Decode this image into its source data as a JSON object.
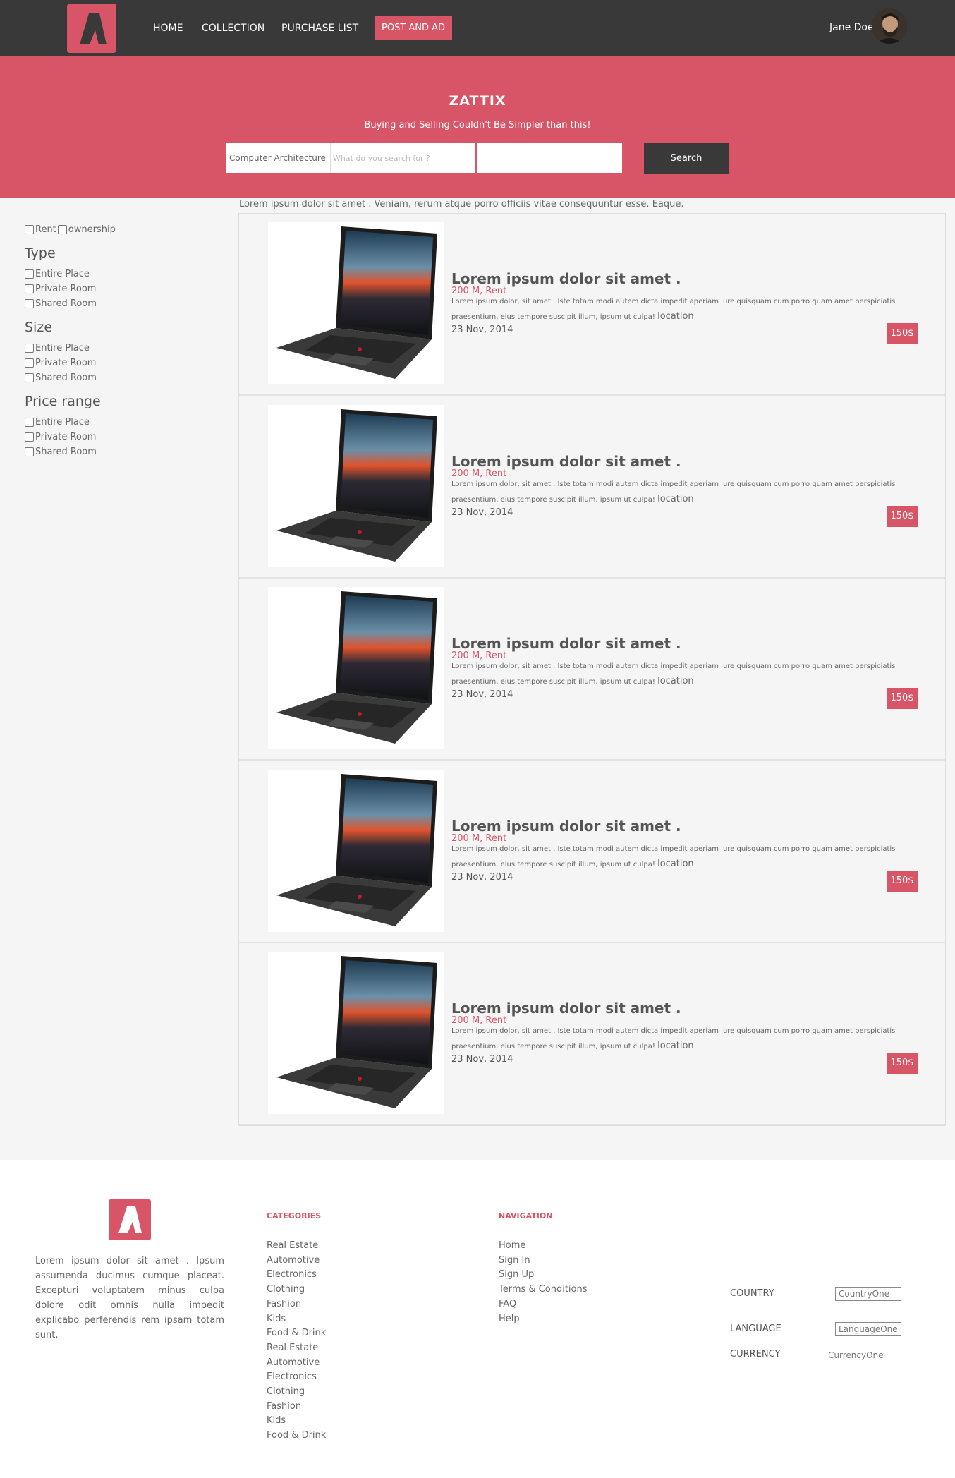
{
  "nav": {
    "home": "HOME",
    "collection": "COLLECTION",
    "purchase_list": "PURCHASE LIST",
    "post_ad": "POST AND AD",
    "user_name": "Jane Doe",
    "logo_icon": "brand-a-logo",
    "avatar_icon": "user-avatar"
  },
  "hero": {
    "title": "ZATTIX",
    "subtitle": "Buying and Selling Couldn't Be Simpler than this!",
    "category": "Computer Architecture",
    "search_placeholder": "What do you search for ?",
    "location_value": "",
    "search_button": "Search"
  },
  "sidebar": {
    "rent": "Rent",
    "ownership": "ownership",
    "groups": [
      {
        "title": "Type",
        "items": [
          "Entire Place",
          "Private Room",
          "Shared Room"
        ]
      },
      {
        "title": "Size",
        "items": [
          "Entire Place",
          "Private Room",
          "Shared Room"
        ]
      },
      {
        "title": "Price range",
        "items": [
          "Entire Place",
          "Private Room",
          "Shared Room"
        ]
      }
    ]
  },
  "listings": {
    "intro": "Lorem ipsum dolor sit amet . Veniam, rerum atque porro officiis vitae consequuntur esse. Eaque.",
    "items": [
      {
        "title": "Lorem ipsum dolor sit amet .",
        "subtitle": "200 M, Rent",
        "description": "Lorem ipsum dolor, sit amet . Iste totam modi autem dicta impedit aperiam iure quisquam cum porro quam amet perspiciatis praesentium, eius tempore suscipit illum, ipsum ut culpa!",
        "location": "location",
        "date": "23 Nov, 2014",
        "price": "150$"
      },
      {
        "title": "Lorem ipsum dolor sit amet .",
        "subtitle": "200 M, Rent",
        "description": "Lorem ipsum dolor, sit amet . Iste totam modi autem dicta impedit aperiam iure quisquam cum porro quam amet perspiciatis praesentium, eius tempore suscipit illum, ipsum ut culpa!",
        "location": "location",
        "date": "23 Nov, 2014",
        "price": "150$"
      },
      {
        "title": "Lorem ipsum dolor sit amet .",
        "subtitle": "200 M, Rent",
        "description": "Lorem ipsum dolor, sit amet . Iste totam modi autem dicta impedit aperiam iure quisquam cum porro quam amet perspiciatis praesentium, eius tempore suscipit illum, ipsum ut culpa!",
        "location": "location",
        "date": "23 Nov, 2014",
        "price": "150$"
      },
      {
        "title": "Lorem ipsum dolor sit amet .",
        "subtitle": "200 M, Rent",
        "description": "Lorem ipsum dolor, sit amet . Iste totam modi autem dicta impedit aperiam iure quisquam cum porro quam amet perspiciatis praesentium, eius tempore suscipit illum, ipsum ut culpa!",
        "location": "location",
        "date": "23 Nov, 2014",
        "price": "150$"
      },
      {
        "title": "Lorem ipsum dolor sit amet .",
        "subtitle": "200 M, Rent",
        "description": "Lorem ipsum dolor, sit amet . Iste totam modi autem dicta impedit aperiam iure quisquam cum porro quam amet perspiciatis praesentium, eius tempore suscipit illum, ipsum ut culpa!",
        "location": "location",
        "date": "23 Nov, 2014",
        "price": "150$"
      }
    ]
  },
  "footer": {
    "about": "Lorem ipsum dolor sit amet . Ipsum assumenda ducimus cumque placeat. Excepturi voluptatem minus culpa dolore odit omnis nulla impedit explicabo perferendis rem ipsam totam sunt,",
    "categories_title": "CATEGORIES",
    "categories": [
      "Real Estate",
      "Automotive",
      "Electronics",
      "Clothing",
      "Fashion",
      "Kids",
      "Food & Drink",
      "Real Estate",
      "Automotive",
      "Electronics",
      "Clothing",
      "Fashion",
      "Kids",
      "Food & Drink"
    ],
    "navigation_title": "NAVIGATION",
    "navigation": [
      "Home",
      "Sign In",
      "Sign Up",
      "Terms & Conditions",
      "FAQ",
      "Help"
    ],
    "country_label": "COUNTRY",
    "country_value": "CountryOne",
    "language_label": "LANGUAGE",
    "language_value": "LanguageOne",
    "currency_label": "CURRENCY",
    "currency_value": "CurrencyOne"
  },
  "colors": {
    "accent": "#d75566",
    "dark": "#393939",
    "background": "#f5f5f5"
  }
}
